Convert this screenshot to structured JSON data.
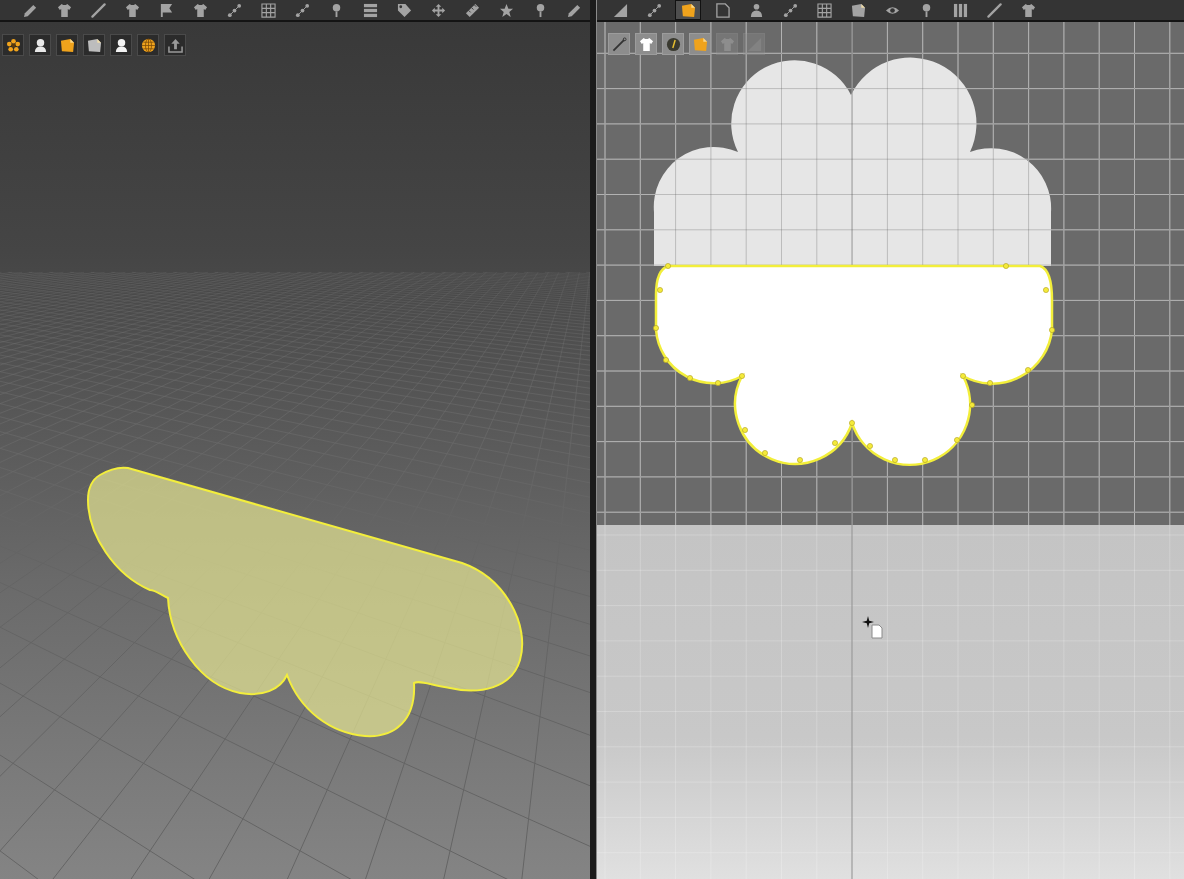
{
  "toolbar_3d": {
    "tools": [
      {
        "selected": false
      },
      {
        "selected": false
      },
      {
        "selected": false
      },
      {
        "selected": false
      },
      {
        "selected": false
      },
      {
        "selected": false
      },
      {
        "selected": false
      },
      {
        "selected": false
      },
      {
        "selected": false
      },
      {
        "selected": false
      },
      {
        "selected": false
      },
      {
        "selected": false
      },
      {
        "selected": false
      },
      {
        "selected": false
      },
      {
        "selected": false
      },
      {
        "selected": false
      },
      {
        "selected": false
      }
    ]
  },
  "view_3d": {
    "display_options": [
      {
        "disabled": false
      },
      {
        "disabled": false
      },
      {
        "disabled": false
      },
      {
        "disabled": false
      },
      {
        "disabled": false
      },
      {
        "disabled": false
      },
      {
        "disabled": false
      }
    ],
    "pattern": {
      "selected": true
    }
  },
  "toolbar_2d": {
    "tools": [
      {
        "selected": false
      },
      {
        "selected": false
      },
      {
        "selected": true
      },
      {
        "selected": false
      },
      {
        "selected": false
      },
      {
        "selected": false
      },
      {
        "selected": false
      },
      {
        "selected": false
      },
      {
        "selected": false
      },
      {
        "selected": false
      },
      {
        "selected": false
      },
      {
        "selected": false
      },
      {
        "selected": false
      }
    ]
  },
  "view_2d": {
    "display_options": [
      {
        "disabled": false
      },
      {
        "disabled": false
      },
      {
        "disabled": false
      },
      {
        "disabled": false
      },
      {
        "disabled": true
      },
      {
        "disabled": true
      }
    ],
    "patterns": [
      {
        "selected": false
      },
      {
        "selected": true
      }
    ]
  }
}
